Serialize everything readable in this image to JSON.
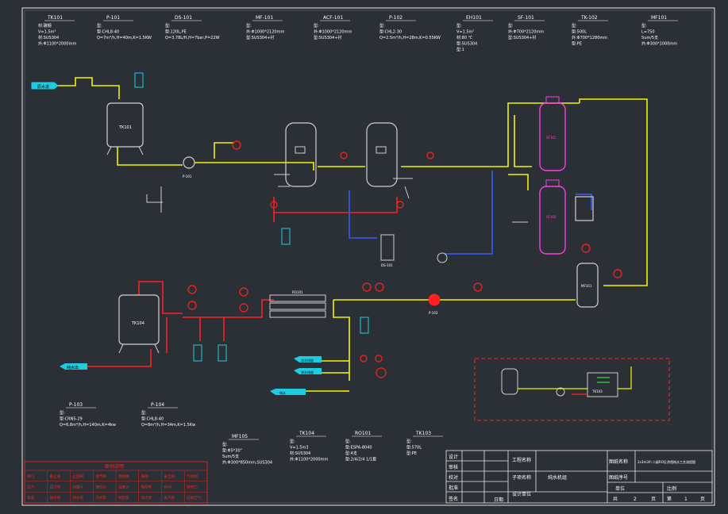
{
  "equipment_specs": [
    {
      "tag": "TK101",
      "lines": [
        "材:碳钢",
        "V=1.5m³",
        "材:SUS304",
        "外:Φ1100*2000mm"
      ]
    },
    {
      "tag": "P-101",
      "lines": [
        "型:",
        "型:CHL8-40",
        "Q=7m³/h,H=40m,K=1.5KW"
      ]
    },
    {
      "tag": "DS-101",
      "lines": [
        "型:",
        "型:120L,PE",
        "Q=3.78L/H,H=7bar,P=22W"
      ]
    },
    {
      "tag": "MF-101",
      "lines": [
        "型:",
        "外:Φ1000*2120mm",
        "型:SUS304+衬"
      ]
    },
    {
      "tag": "ACF-101",
      "lines": [
        "型:",
        "外:Φ1000*2120mm",
        "型:SUS304+衬"
      ]
    },
    {
      "tag": "P-102",
      "lines": [
        "型:",
        "型:CHL2-30",
        "Q=2.5m³/h,H=28m,K=0.55KW"
      ]
    },
    {
      "tag": "EH101",
      "lines": [
        "型:",
        "V=1.5m²",
        "材:80 ℃",
        "型:SUS304",
        "型:1"
      ]
    },
    {
      "tag": "SF-101",
      "lines": [
        "型:",
        "外:Φ700*2120mm",
        "型:SUS304+衬"
      ]
    },
    {
      "tag": "TK-102",
      "lines": [
        "型:",
        "型:500L",
        "外:Φ700*1280mm",
        "型:PE"
      ]
    },
    {
      "tag": "MF101",
      "lines": [
        "型:",
        "L=750",
        "5um/5支",
        "外:Φ300*1000mm"
      ]
    },
    {
      "tag": "P-103",
      "lines": [
        "型:",
        "型:CRN5-29",
        "Q=6.8m³/h,H=140m,K=4kw"
      ]
    },
    {
      "tag": "P-104",
      "lines": [
        "型:",
        "型:CHL8-40",
        "Q=8m³/h,H=34m,K=1.5Kw"
      ]
    },
    {
      "tag": "MF105",
      "lines": [
        "型:",
        "型:Φ5*30\"",
        "5um/5支",
        "外:Φ300*850mm,SUS304"
      ]
    },
    {
      "tag": "TK104",
      "lines": [
        "型:",
        "V=1.5m3",
        "材:SUS304",
        "外:Φ1100*2000mm"
      ]
    },
    {
      "tag": "RO101",
      "lines": [
        "型:",
        "型:ESPA-8040",
        "型:4支",
        "型:2/4/2/4 1/1套"
      ]
    },
    {
      "tag": "TK103",
      "lines": [
        "型:",
        "型:570L",
        "型:PE"
      ]
    }
  ],
  "diagram_labels": {
    "raw_water": "原水进",
    "pure_water_out": "纯水出",
    "tank1": "TK101",
    "tank4": "TK104",
    "tank3": "TK103",
    "pump_p1": "P-101",
    "pump_p2": "P-102",
    "pump_p3": "P-103",
    "pump_p4": "P-104",
    "mf_filter": "MF101",
    "ro_unit": "RO101",
    "sf1": "SF101",
    "sf2": "SF102",
    "dosing": "DS-101",
    "concentrate_a": "浓水排放",
    "concentrate_b": "浓水排放",
    "reject_out": "排水"
  },
  "legend": {
    "title": "图例说明",
    "rows": [
      [
        "阀门",
        "截止阀",
        "止回阀",
        "调节阀",
        "电磁阀",
        "蝶阀",
        "安全阀",
        "气动阀"
      ],
      [
        "压力",
        "压力表",
        "流量计",
        "液位计",
        "温度计",
        "电导率",
        "PH计",
        "取样口"
      ],
      [
        "管道",
        "给水管",
        "纯水管",
        "浓水管",
        "加药管",
        "排污管",
        "蒸汽管",
        "压缩空气"
      ]
    ]
  },
  "title_block": {
    "left_labels": [
      "设计",
      "审核",
      "校对",
      "批准",
      "签名"
    ],
    "project_name_label": "工程名称",
    "sub_project_label": "子项名称",
    "design_unit_label": "设计单位",
    "date_label": "日期",
    "sub_project_value": "纯水机组",
    "drawing_name_label": "图纸名称",
    "drawing_name_value": "2x3m3/h 二级RO反渗透纯水工艺流程图",
    "drawing_no_label": "图纸序号",
    "unit_label": "单位",
    "scale_label": "比例",
    "total_label": "共",
    "total_value": "2",
    "page_label": "页",
    "sheet_label": "第",
    "sheet_value": "1",
    "sheet_page_label": "页"
  }
}
